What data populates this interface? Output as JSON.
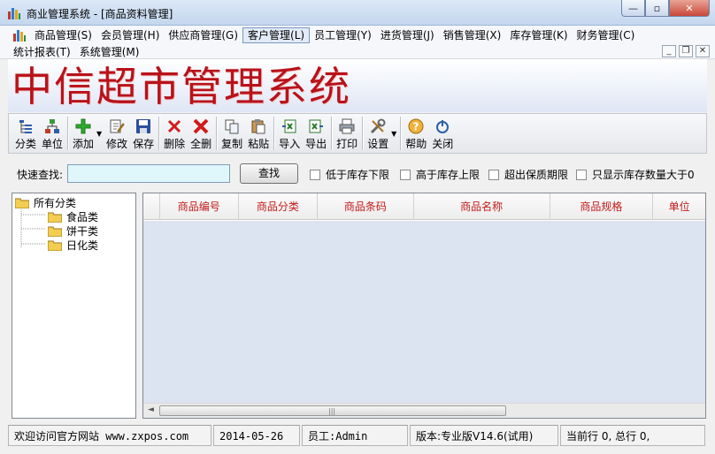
{
  "window": {
    "title": "商业管理系统 - [商品资料管理]",
    "buttons": {
      "minimize": "—",
      "maximize": "▫",
      "close": "✕"
    }
  },
  "menubar": {
    "row1": [
      "商品管理(S)",
      "会员管理(H)",
      "供应商管理(G)",
      "客户管理(L)",
      "员工管理(Y)",
      "进货管理(J)",
      "销售管理(X)",
      "库存管理(K)",
      "财务管理(C)"
    ],
    "row2": [
      "统计报表(T)",
      "系统管理(M)"
    ],
    "active_index": 3,
    "mdi_buttons": {
      "minimize": "_",
      "restore": "❐",
      "close": "✕"
    }
  },
  "banner": {
    "title": "中信超市管理系统"
  },
  "toolbar": {
    "category": "分类",
    "unit": "单位",
    "add": "添加",
    "edit": "修改",
    "save": "保存",
    "delete": "删除",
    "delete_all": "全删",
    "copy": "复制",
    "paste": "粘贴",
    "import": "导入",
    "export": "导出",
    "print": "打印",
    "settings": "设置",
    "help": "帮助",
    "close": "关闭"
  },
  "search": {
    "label": "快速查找:",
    "value": "",
    "button": "查找",
    "checkboxes": [
      "低于库存下限",
      "高于库存上限",
      "超出保质期限",
      "只显示库存数量大于0"
    ]
  },
  "tree": {
    "root": "所有分类",
    "children": [
      "食品类",
      "饼干类",
      "日化类"
    ]
  },
  "grid": {
    "columns": [
      "商品编号",
      "商品分类",
      "商品条码",
      "商品名称",
      "商品规格",
      "单位"
    ],
    "scroll_left": "◄",
    "scroll_grip": "|||"
  },
  "statusbar": {
    "website": "欢迎访问官方网站 www.zxpos.com",
    "date": "2014-05-26",
    "employee": "员工:Admin",
    "version": "版本:专业版V14.6(试用)",
    "rows": "当前行 0, 总行 0,"
  }
}
